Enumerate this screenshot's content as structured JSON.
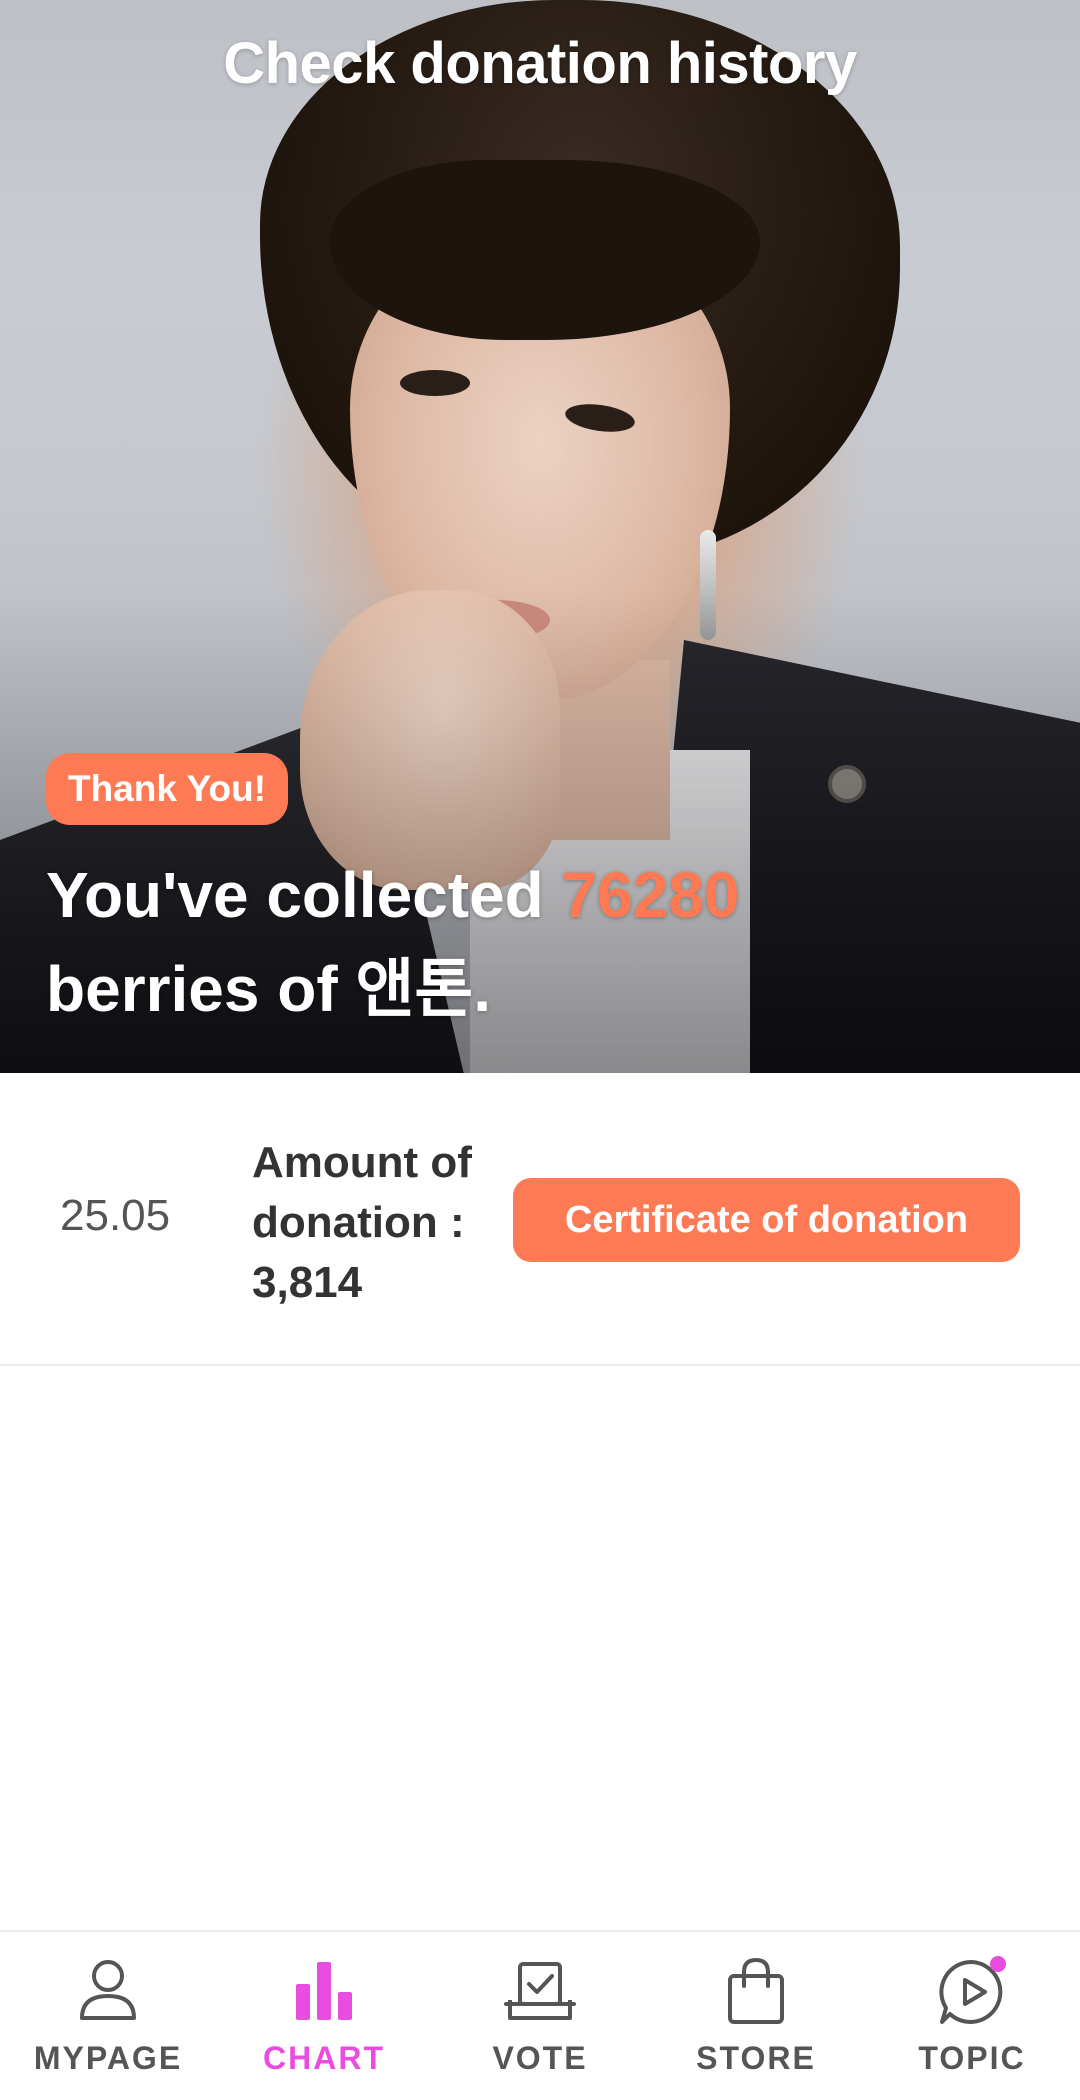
{
  "header": {
    "title": "Check donation history"
  },
  "hero": {
    "badge": "Thank You!",
    "line_prefix": "You've collected ",
    "amount": "76280",
    "line_suffix": "berries of 앤톤."
  },
  "donations": [
    {
      "date": "25.05",
      "amount_label": "Amount of donation : 3,814",
      "button_label": "Certificate of donation"
    }
  ],
  "nav": {
    "active": "CHART",
    "items": [
      {
        "label": "MYPAGE",
        "icon": "person-icon"
      },
      {
        "label": "CHART",
        "icon": "bar-chart-icon"
      },
      {
        "label": "VOTE",
        "icon": "ballot-box-icon"
      },
      {
        "label": "STORE",
        "icon": "shopping-bag-icon"
      },
      {
        "label": "TOPIC",
        "icon": "play-bubble-icon",
        "badge": true
      }
    ]
  },
  "colors": {
    "accent": "#fd7a55",
    "amount_highlight": "#ff7a52",
    "nav_active": "#e94de0",
    "nav_inactive": "#555555"
  }
}
